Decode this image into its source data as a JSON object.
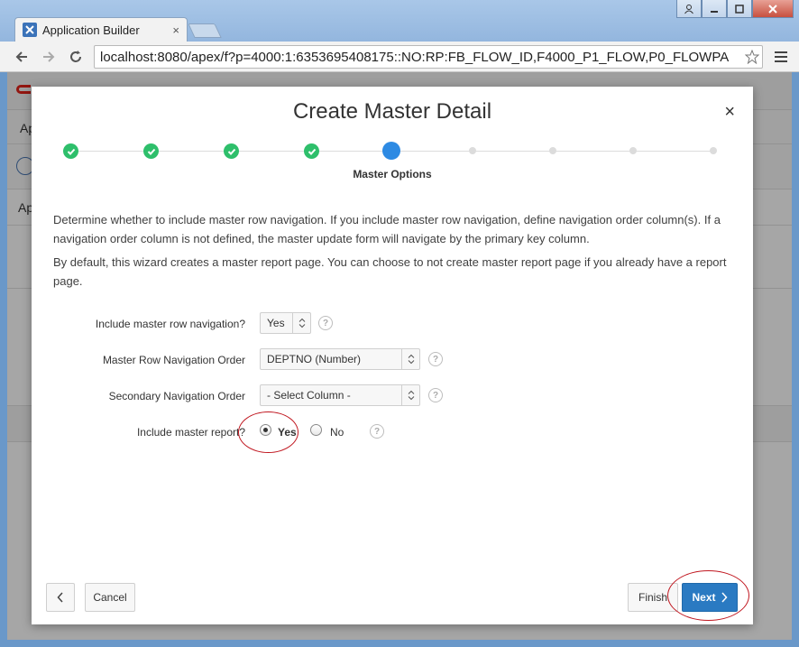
{
  "browser": {
    "tab_title": "Application Builder",
    "tab_close": "×",
    "url": "localhost:8080/apex/f?p=4000:1:6353695408175::NO:RP:FB_FLOW_ID,F4000_P1_FLOW,P0_FLOWPA"
  },
  "background_page": {
    "header_text": "Ap",
    "section_text": "Ap"
  },
  "dialog": {
    "title": "Create Master Detail",
    "close": "×",
    "current_step_label": "Master Options",
    "steps": [
      "complete",
      "complete",
      "complete",
      "complete",
      "current",
      "pending",
      "pending",
      "pending",
      "pending"
    ],
    "description_1": "Determine whether to include master row navigation. If you include master row navigation, define navigation order column(s). If a navigation order column is not defined, the master update form will navigate by the primary key column.",
    "description_2": "By default, this wizard creates a master report page. You can choose to not create master report page if you already have a report page.",
    "fields": {
      "row_nav": {
        "label": "Include master row navigation?",
        "value": "Yes"
      },
      "nav_order": {
        "label": "Master Row Navigation Order",
        "value": "DEPTNO (Number)"
      },
      "secondary_order": {
        "label": "Secondary Navigation Order",
        "value": "- Select Column -"
      },
      "master_report": {
        "label": "Include master report?",
        "option_yes": "Yes",
        "option_no": "No",
        "selected": "Yes"
      }
    },
    "help_icon": "?",
    "buttons": {
      "back": "‹",
      "cancel": "Cancel",
      "finish": "Finish",
      "next": "Next"
    }
  },
  "colors": {
    "step_complete": "#2ebf6b",
    "step_current": "#2d8ae3",
    "primary_button": "#2a7ac2",
    "annotation": "#c0161f"
  }
}
